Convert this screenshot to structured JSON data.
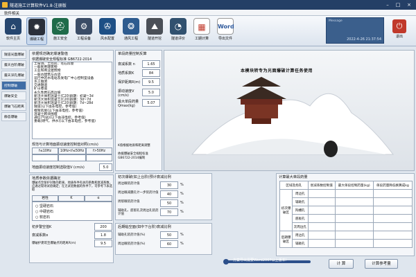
{
  "window": {
    "title": "隧道施工计算软件V1.8-注册版",
    "menu": "软件相关"
  },
  "toolbar": {
    "items": [
      {
        "label": "软件主页",
        "icon": "home"
      },
      {
        "label": "爆破工程",
        "icon": "blast"
      },
      {
        "label": "施工安全",
        "icon": "safety"
      },
      {
        "label": "工程设备",
        "icon": "equipment"
      },
      {
        "label": "风水配置",
        "icon": "fan"
      },
      {
        "label": "通风工程",
        "icon": "ventilation"
      },
      {
        "label": "隧道开挖",
        "icon": "excavation"
      },
      {
        "label": "隧道评价",
        "icon": "evaluation"
      },
      {
        "label": "工期计算",
        "icon": "calendar"
      },
      {
        "label": "导出文件",
        "icon": "word"
      }
    ],
    "word_text": "Word",
    "message_label": "Message",
    "datetime": "2022-4-26  21:37:54",
    "exit_label": "退出"
  },
  "sidebar": {
    "items": [
      "隧道光面爆破",
      "露天台阶爆破",
      "露天深孔爆破",
      "控制爆破",
      "爆破安全",
      "爆破飞石距离",
      "静态爆破"
    ],
    "active_index": 3
  },
  "safety_panel": {
    "title": "依据规范确定爆速警值",
    "standard": "依据爆破安全规程标准   GB6722-2014",
    "list": [
      "土窑洞、土坯房、毛石房屋",
      "一般民用建筑物",
      "工业和商业建筑物",
      "一般古建筑与古迹",
      "运行中的水电站及发电厂中心控制室设备",
      "水工隧洞",
      "交通隧道",
      "矿山巷道",
      "永久性岩石高边坡",
      "新浇大体积混凝土(C20)龄期：初凝~3d",
      "新浇大体积混凝土(C20)龄期：3d~7d",
      "新浇大体积混凝土(C20)龄期：7d~28d",
      "隧道(以下由非电控，参考值)",
      "框架房屋(以下由非电控，参考值)",
      "混凝土砌块围墙",
      "通信(气站)(以下由非电控，参考值)",
      "重载(燃气、供水)(以下由非电控，参考值)"
    ],
    "freq_title": "规范与计算地面振动速度控制值对照(cm/s)",
    "freq_headers": [
      "f≤10Hz",
      "10Hz<f≤50Hz",
      "f>50Hz"
    ],
    "vel_label": "地面振动速度控制选取值V (cm/s)",
    "vel_value": "5.0"
  },
  "single_panel": {
    "title": "单段药量控制反算",
    "fields": [
      {
        "label": "衰减系数 n",
        "value": "1.65"
      },
      {
        "label": "地质系数K",
        "value": "84"
      },
      {
        "label": "保护距离R(m)",
        "value": "9.5"
      },
      {
        "label": "振动速度V (cm/s)",
        "value": "5.0"
      },
      {
        "label": "最大单段药量 Qmax(kg)",
        "value": "5.07"
      }
    ],
    "note1": "K值根据地质和距离调整",
    "note2": "依据爆破安全规程标准 GB6722-2014编制"
  },
  "banner": "本模块转专为光面爆破计算任务使用",
  "test_panel": {
    "title": "地质参数依据确定",
    "desc": "爆破点至保护对象的距离、地质条件有关的系数和衰减系数，应通过现场试验确定；在无试验数据的条件下，可参考下表选取",
    "headers": [
      "岩性",
      "K",
      "α"
    ],
    "rows": [
      "坚硬岩石",
      "中硬岩石",
      "软岩石"
    ]
  },
  "params": [
    {
      "label": "初步警空值K",
      "value": "200"
    },
    {
      "label": "衰减系数α",
      "value": "1.8"
    },
    {
      "label": "爆破护建筑至爆破点的距离R(m)",
      "value": "9.5"
    }
  ],
  "delay_panel": {
    "title": "初次爆破(如上台阶)预计衰减比例",
    "rows": [
      {
        "label": "周边眼装药计值",
        "value": "30",
        "unit": "%"
      },
      {
        "label": "周边眼减震孔计一步装药计值",
        "value": "40",
        "unit": "%"
      },
      {
        "label": "周帮眼装药计值",
        "value": "50",
        "unit": "%"
      },
      {
        "label": "辅助孔、底帮孔次周边孔装药计值",
        "value": "70",
        "unit": "%"
      }
    ]
  },
  "second_panel": {
    "title": "后期临空面(如中下台阶)衰减比例",
    "rows": [
      {
        "label": "辅助孔装药计值(%)",
        "value": "50",
        "unit": "%"
      },
      {
        "label": "周边眼装药计值(%)",
        "value": "60",
        "unit": "%"
      }
    ]
  },
  "result_panel": {
    "title": "计算最大单段药量",
    "headers": [
      "区域及炮孔",
      "衰减系数控制值",
      "最大单段控制药量(kg)",
      "单段药量降低换算成kg"
    ],
    "group1": "初次爆破区",
    "group2": "后期爆破区",
    "rows": [
      "周边孔",
      "辅助孔",
      "掏槽孔",
      "底板孔",
      "次周边孔",
      "周边孔",
      "辅助孔"
    ]
  },
  "footer": {
    "hint": "方案导出需要Word2007以上版本!",
    "calc": "计  算",
    "calc_help": "计算参考量"
  },
  "colors": {
    "title": "#243f66",
    "accent": "#3f6da6"
  }
}
